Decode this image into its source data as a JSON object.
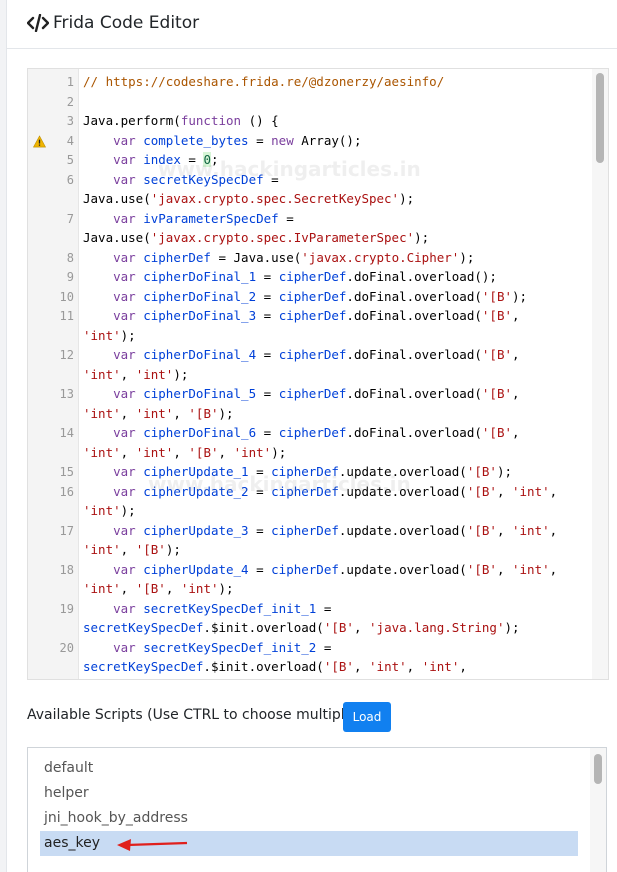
{
  "header": {
    "title": "Frida Code Editor",
    "icon": "code-icon"
  },
  "editor": {
    "watermark": "www.hackingarticles.in",
    "warning_line": 4,
    "lines": [
      {
        "n": "1",
        "tokens": [
          [
            "c",
            "// https://codeshare.frida.re/@dzonerzy/aesinfo/"
          ]
        ]
      },
      {
        "n": "2",
        "tokens": []
      },
      {
        "n": "3",
        "tokens": [
          [
            "p",
            "Java.perform("
          ],
          [
            "k",
            "function"
          ],
          [
            "p",
            " () {"
          ]
        ]
      },
      {
        "n": "4",
        "tokens": [
          [
            "p",
            "    "
          ],
          [
            "k",
            "var"
          ],
          [
            "p",
            " "
          ],
          [
            "d",
            "complete_bytes"
          ],
          [
            "p",
            " = "
          ],
          [
            "k",
            "new"
          ],
          [
            "p",
            " Array();"
          ]
        ]
      },
      {
        "n": "5",
        "tokens": [
          [
            "p",
            "    "
          ],
          [
            "k",
            "var"
          ],
          [
            "p",
            " "
          ],
          [
            "d",
            "index"
          ],
          [
            "p",
            " = "
          ],
          [
            "n",
            "0"
          ],
          [
            "p",
            ";"
          ]
        ]
      },
      {
        "n": "6",
        "tokens": [
          [
            "p",
            "    "
          ],
          [
            "k",
            "var"
          ],
          [
            "p",
            " "
          ],
          [
            "d",
            "secretKeySpecDef"
          ],
          [
            "p",
            " ="
          ]
        ]
      },
      {
        "n": "",
        "tokens": [
          [
            "p",
            "Java.use("
          ],
          [
            "s",
            "'javax.crypto.spec.SecretKeySpec'"
          ],
          [
            "p",
            ");"
          ]
        ]
      },
      {
        "n": "7",
        "tokens": [
          [
            "p",
            "    "
          ],
          [
            "k",
            "var"
          ],
          [
            "p",
            " "
          ],
          [
            "d",
            "ivParameterSpecDef"
          ],
          [
            "p",
            " ="
          ]
        ]
      },
      {
        "n": "",
        "tokens": [
          [
            "p",
            "Java.use("
          ],
          [
            "s",
            "'javax.crypto.spec.IvParameterSpec'"
          ],
          [
            "p",
            ");"
          ]
        ]
      },
      {
        "n": "8",
        "tokens": [
          [
            "p",
            "    "
          ],
          [
            "k",
            "var"
          ],
          [
            "p",
            " "
          ],
          [
            "d",
            "cipherDef"
          ],
          [
            "p",
            " = Java.use("
          ],
          [
            "s",
            "'javax.crypto.Cipher'"
          ],
          [
            "p",
            ");"
          ]
        ]
      },
      {
        "n": "9",
        "tokens": [
          [
            "p",
            "    "
          ],
          [
            "k",
            "var"
          ],
          [
            "p",
            " "
          ],
          [
            "d",
            "cipherDoFinal_1"
          ],
          [
            "p",
            " = "
          ],
          [
            "d",
            "cipherDef"
          ],
          [
            "p",
            ".doFinal.overload();"
          ]
        ]
      },
      {
        "n": "10",
        "tokens": [
          [
            "p",
            "    "
          ],
          [
            "k",
            "var"
          ],
          [
            "p",
            " "
          ],
          [
            "d",
            "cipherDoFinal_2"
          ],
          [
            "p",
            " = "
          ],
          [
            "d",
            "cipherDef"
          ],
          [
            "p",
            ".doFinal.overload("
          ],
          [
            "s",
            "'[B'"
          ],
          [
            "p",
            ");"
          ]
        ]
      },
      {
        "n": "11",
        "tokens": [
          [
            "p",
            "    "
          ],
          [
            "k",
            "var"
          ],
          [
            "p",
            " "
          ],
          [
            "d",
            "cipherDoFinal_3"
          ],
          [
            "p",
            " = "
          ],
          [
            "d",
            "cipherDef"
          ],
          [
            "p",
            ".doFinal.overload("
          ],
          [
            "s",
            "'[B'"
          ],
          [
            "p",
            ","
          ]
        ]
      },
      {
        "n": "",
        "tokens": [
          [
            "s",
            "'int'"
          ],
          [
            "p",
            ");"
          ]
        ]
      },
      {
        "n": "12",
        "tokens": [
          [
            "p",
            "    "
          ],
          [
            "k",
            "var"
          ],
          [
            "p",
            " "
          ],
          [
            "d",
            "cipherDoFinal_4"
          ],
          [
            "p",
            " = "
          ],
          [
            "d",
            "cipherDef"
          ],
          [
            "p",
            ".doFinal.overload("
          ],
          [
            "s",
            "'[B'"
          ],
          [
            "p",
            ","
          ]
        ]
      },
      {
        "n": "",
        "tokens": [
          [
            "s",
            "'int'"
          ],
          [
            "p",
            ", "
          ],
          [
            "s",
            "'int'"
          ],
          [
            "p",
            ");"
          ]
        ]
      },
      {
        "n": "13",
        "tokens": [
          [
            "p",
            "    "
          ],
          [
            "k",
            "var"
          ],
          [
            "p",
            " "
          ],
          [
            "d",
            "cipherDoFinal_5"
          ],
          [
            "p",
            " = "
          ],
          [
            "d",
            "cipherDef"
          ],
          [
            "p",
            ".doFinal.overload("
          ],
          [
            "s",
            "'[B'"
          ],
          [
            "p",
            ","
          ]
        ]
      },
      {
        "n": "",
        "tokens": [
          [
            "s",
            "'int'"
          ],
          [
            "p",
            ", "
          ],
          [
            "s",
            "'int'"
          ],
          [
            "p",
            ", "
          ],
          [
            "s",
            "'[B'"
          ],
          [
            "p",
            ");"
          ]
        ]
      },
      {
        "n": "14",
        "tokens": [
          [
            "p",
            "    "
          ],
          [
            "k",
            "var"
          ],
          [
            "p",
            " "
          ],
          [
            "d",
            "cipherDoFinal_6"
          ],
          [
            "p",
            " = "
          ],
          [
            "d",
            "cipherDef"
          ],
          [
            "p",
            ".doFinal.overload("
          ],
          [
            "s",
            "'[B'"
          ],
          [
            "p",
            ","
          ]
        ]
      },
      {
        "n": "",
        "tokens": [
          [
            "s",
            "'int'"
          ],
          [
            "p",
            ", "
          ],
          [
            "s",
            "'int'"
          ],
          [
            "p",
            ", "
          ],
          [
            "s",
            "'[B'"
          ],
          [
            "p",
            ", "
          ],
          [
            "s",
            "'int'"
          ],
          [
            "p",
            ");"
          ]
        ]
      },
      {
        "n": "15",
        "tokens": [
          [
            "p",
            "    "
          ],
          [
            "k",
            "var"
          ],
          [
            "p",
            " "
          ],
          [
            "d",
            "cipherUpdate_1"
          ],
          [
            "p",
            " = "
          ],
          [
            "d",
            "cipherDef"
          ],
          [
            "p",
            ".update.overload("
          ],
          [
            "s",
            "'[B'"
          ],
          [
            "p",
            ");"
          ]
        ]
      },
      {
        "n": "16",
        "tokens": [
          [
            "p",
            "    "
          ],
          [
            "k",
            "var"
          ],
          [
            "p",
            " "
          ],
          [
            "d",
            "cipherUpdate_2"
          ],
          [
            "p",
            " = "
          ],
          [
            "d",
            "cipherDef"
          ],
          [
            "p",
            ".update.overload("
          ],
          [
            "s",
            "'[B'"
          ],
          [
            "p",
            ", "
          ],
          [
            "s",
            "'int'"
          ],
          [
            "p",
            ","
          ]
        ]
      },
      {
        "n": "",
        "tokens": [
          [
            "s",
            "'int'"
          ],
          [
            "p",
            ");"
          ]
        ]
      },
      {
        "n": "17",
        "tokens": [
          [
            "p",
            "    "
          ],
          [
            "k",
            "var"
          ],
          [
            "p",
            " "
          ],
          [
            "d",
            "cipherUpdate_3"
          ],
          [
            "p",
            " = "
          ],
          [
            "d",
            "cipherDef"
          ],
          [
            "p",
            ".update.overload("
          ],
          [
            "s",
            "'[B'"
          ],
          [
            "p",
            ", "
          ],
          [
            "s",
            "'int'"
          ],
          [
            "p",
            ","
          ]
        ]
      },
      {
        "n": "",
        "tokens": [
          [
            "s",
            "'int'"
          ],
          [
            "p",
            ", "
          ],
          [
            "s",
            "'[B'"
          ],
          [
            "p",
            ");"
          ]
        ]
      },
      {
        "n": "18",
        "tokens": [
          [
            "p",
            "    "
          ],
          [
            "k",
            "var"
          ],
          [
            "p",
            " "
          ],
          [
            "d",
            "cipherUpdate_4"
          ],
          [
            "p",
            " = "
          ],
          [
            "d",
            "cipherDef"
          ],
          [
            "p",
            ".update.overload("
          ],
          [
            "s",
            "'[B'"
          ],
          [
            "p",
            ", "
          ],
          [
            "s",
            "'int'"
          ],
          [
            "p",
            ","
          ]
        ]
      },
      {
        "n": "",
        "tokens": [
          [
            "s",
            "'int'"
          ],
          [
            "p",
            ", "
          ],
          [
            "s",
            "'[B'"
          ],
          [
            "p",
            ", "
          ],
          [
            "s",
            "'int'"
          ],
          [
            "p",
            ");"
          ]
        ]
      },
      {
        "n": "19",
        "tokens": [
          [
            "p",
            "    "
          ],
          [
            "k",
            "var"
          ],
          [
            "p",
            " "
          ],
          [
            "d",
            "secretKeySpecDef_init_1"
          ],
          [
            "p",
            " ="
          ]
        ]
      },
      {
        "n": "",
        "tokens": [
          [
            "d",
            "secretKeySpecDef"
          ],
          [
            "p",
            ".$init.overload("
          ],
          [
            "s",
            "'[B'"
          ],
          [
            "p",
            ", "
          ],
          [
            "s",
            "'java.lang.String'"
          ],
          [
            "p",
            ");"
          ]
        ]
      },
      {
        "n": "20",
        "tokens": [
          [
            "p",
            "    "
          ],
          [
            "k",
            "var"
          ],
          [
            "p",
            " "
          ],
          [
            "d",
            "secretKeySpecDef_init_2"
          ],
          [
            "p",
            " ="
          ]
        ]
      },
      {
        "n": "",
        "tokens": [
          [
            "d",
            "secretKeySpecDef"
          ],
          [
            "p",
            ".$init.overload("
          ],
          [
            "s",
            "'[B'"
          ],
          [
            "p",
            ", "
          ],
          [
            "s",
            "'int'"
          ],
          [
            "p",
            ", "
          ],
          [
            "s",
            "'int'"
          ],
          [
            "p",
            ","
          ]
        ]
      }
    ]
  },
  "scripts": {
    "label": "Available Scripts (Use CTRL to choose multiple)",
    "load_label": "Load",
    "options": [
      "default",
      "helper",
      "jni_hook_by_address",
      "aes_key"
    ],
    "selected": "aes_key"
  },
  "colors": {
    "accent": "#1180f0",
    "selection": "#c8dbf3",
    "arrow": "#e0201c"
  }
}
